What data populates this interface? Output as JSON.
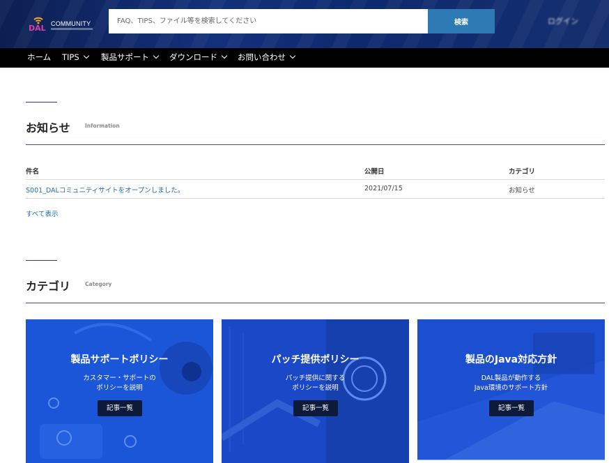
{
  "header": {
    "logo_word": "COMMUNITY",
    "logo_letters": "DAL",
    "search_placeholder": "FAQ、TIPS、ファイル等を検索してください",
    "search_button": "検索",
    "login_label": "ログイン"
  },
  "nav": {
    "items": [
      {
        "label": "ホーム",
        "has_dropdown": false
      },
      {
        "label": "TIPS",
        "has_dropdown": true
      },
      {
        "label": "製品サポート",
        "has_dropdown": true
      },
      {
        "label": "ダウンロード",
        "has_dropdown": true
      },
      {
        "label": "お問い合わせ",
        "has_dropdown": true
      }
    ]
  },
  "news": {
    "title": "お知らせ",
    "subtitle": "Information",
    "columns": [
      "件名",
      "公開日",
      "カテゴリ"
    ],
    "rows": [
      {
        "subject": "S001_DALコミュニティサイトをオープンしました。",
        "date": "2021/07/15",
        "category": "お知らせ"
      }
    ],
    "show_all": "すべて表示"
  },
  "category": {
    "title": "カテゴリ",
    "subtitle": "Category",
    "cards": [
      {
        "title": "製品サポートポリシー",
        "desc": [
          "カスタマー・サポートの",
          "ポリシーを説明"
        ],
        "button": "記事一覧"
      },
      {
        "title": "パッチ提供ポリシー",
        "desc": [
          "パッチ提供に関する",
          "ポリシーを説明"
        ],
        "button": "記事一覧"
      },
      {
        "title": "製品のJava対応方針",
        "desc": [
          "DAL製品が動作する",
          "Java環境のサポート方針"
        ],
        "button": "記事一覧"
      }
    ]
  },
  "colors": {
    "header_bg": "#13307a",
    "nav_bg": "#000000",
    "search_button": "#2d7ab5",
    "link": "#1f6cb0",
    "accent_line": "#5b2a8c",
    "card_blue": "#1a4fd0"
  }
}
